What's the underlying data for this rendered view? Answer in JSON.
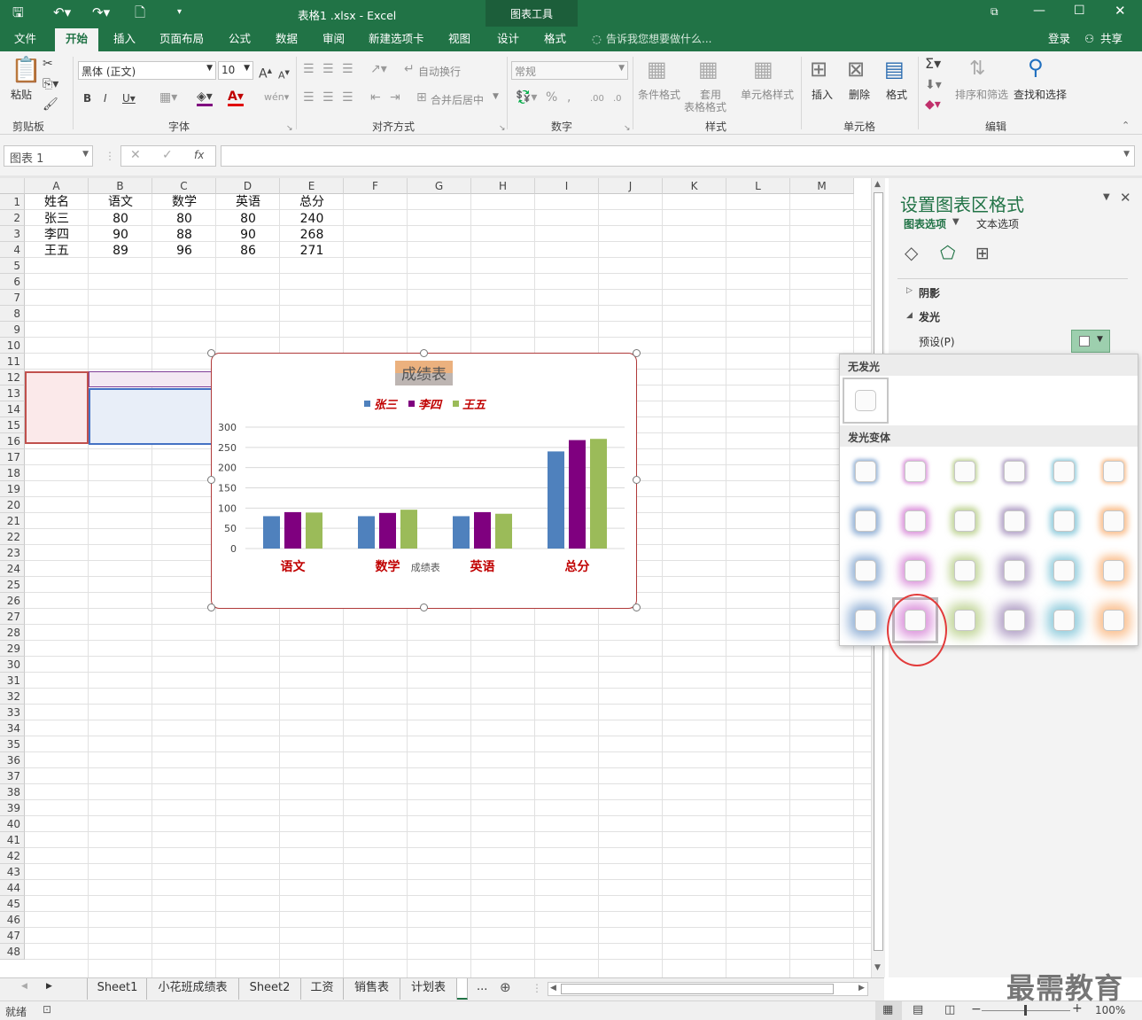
{
  "titlebar": {
    "doc_title": "表格1 .xlsx - Excel",
    "context_tools": "图表工具",
    "login": "登录",
    "share": "共享"
  },
  "menu": {
    "items": [
      "文件",
      "开始",
      "插入",
      "页面布局",
      "公式",
      "数据",
      "审阅",
      "新建选项卡",
      "视图",
      "设计",
      "格式"
    ],
    "tell_me": "告诉我您想要做什么..."
  },
  "ribbon": {
    "clipboard": {
      "paste": "粘贴",
      "label": "剪贴板"
    },
    "font": {
      "name": "黑体 (正文)",
      "size": "10",
      "label": "字体"
    },
    "align": {
      "wrap": "自动换行",
      "merge": "合并后居中",
      "label": "对齐方式"
    },
    "number": {
      "format": "常规",
      "label": "数字"
    },
    "styles": {
      "cond": "条件格式",
      "table_fmt_1": "套用",
      "table_fmt_2": "表格格式",
      "cell_style": "单元格样式",
      "label": "样式"
    },
    "cells": {
      "insert": "插入",
      "delete": "删除",
      "format": "格式",
      "label": "单元格"
    },
    "editing": {
      "sort": "排序和筛选",
      "find": "查找和选择",
      "label": "编辑"
    }
  },
  "formula": {
    "namebox": "图表 1",
    "fx": "fx"
  },
  "grid": {
    "columns": [
      "A",
      "B",
      "C",
      "D",
      "E",
      "F",
      "G",
      "H",
      "I",
      "J",
      "K",
      "L",
      "M"
    ],
    "rows": [
      "1",
      "2",
      "3",
      "4",
      "5",
      "6",
      "7",
      "8",
      "9",
      "10",
      "11",
      "12",
      "13",
      "14",
      "15",
      "16",
      "17",
      "18",
      "19",
      "20",
      "21",
      "22",
      "23",
      "24",
      "25",
      "26",
      "27",
      "28",
      "29",
      "30",
      "31",
      "32",
      "33",
      "34",
      "35",
      "36",
      "37",
      "38",
      "39",
      "40",
      "41",
      "42",
      "43",
      "44",
      "45",
      "46",
      "47",
      "48"
    ],
    "table": [
      [
        "姓名",
        "语文",
        "数学",
        "英语",
        "总分"
      ],
      [
        "张三",
        "80",
        "80",
        "80",
        "240"
      ],
      [
        "李四",
        "90",
        "88",
        "90",
        "268"
      ],
      [
        "王五",
        "89",
        "96",
        "86",
        "271"
      ]
    ]
  },
  "chart_data": {
    "type": "bar",
    "title": "成绩表",
    "xlabel": "成绩表",
    "categories": [
      "语文",
      "数学",
      "英语",
      "总分"
    ],
    "series": [
      {
        "name": "张三",
        "values": [
          80,
          80,
          80,
          240
        ],
        "color": "#4f81bd"
      },
      {
        "name": "李四",
        "values": [
          90,
          88,
          90,
          268
        ],
        "color": "#7f007f"
      },
      {
        "name": "王五",
        "values": [
          89,
          96,
          86,
          271
        ],
        "color": "#9bbb59"
      }
    ],
    "ylim": [
      0,
      300
    ],
    "yticks": [
      "300",
      "250",
      "200",
      "150",
      "100",
      "50",
      "0"
    ],
    "legend": "top",
    "grid": true
  },
  "pane": {
    "title": "设置图表区格式",
    "tab_chart": "图表选项",
    "tab_text": "文本选项",
    "shadow": "阴影",
    "glow": "发光",
    "preset": "预设(P)"
  },
  "gallery": {
    "no_glow": "无发光",
    "variants": "发光变体",
    "colors": [
      "#4f81bd",
      "#c44fc4",
      "#9bbb59",
      "#8064a2",
      "#4bacc6",
      "#f79646"
    ]
  },
  "sheets": {
    "tabs": [
      "Sheet1",
      "小花班成绩表",
      "Sheet2",
      "工资",
      "销售表",
      "计划表"
    ],
    "more": "..."
  },
  "status": {
    "ready": "就绪",
    "zoom": "100%"
  },
  "watermark": "最需教育"
}
